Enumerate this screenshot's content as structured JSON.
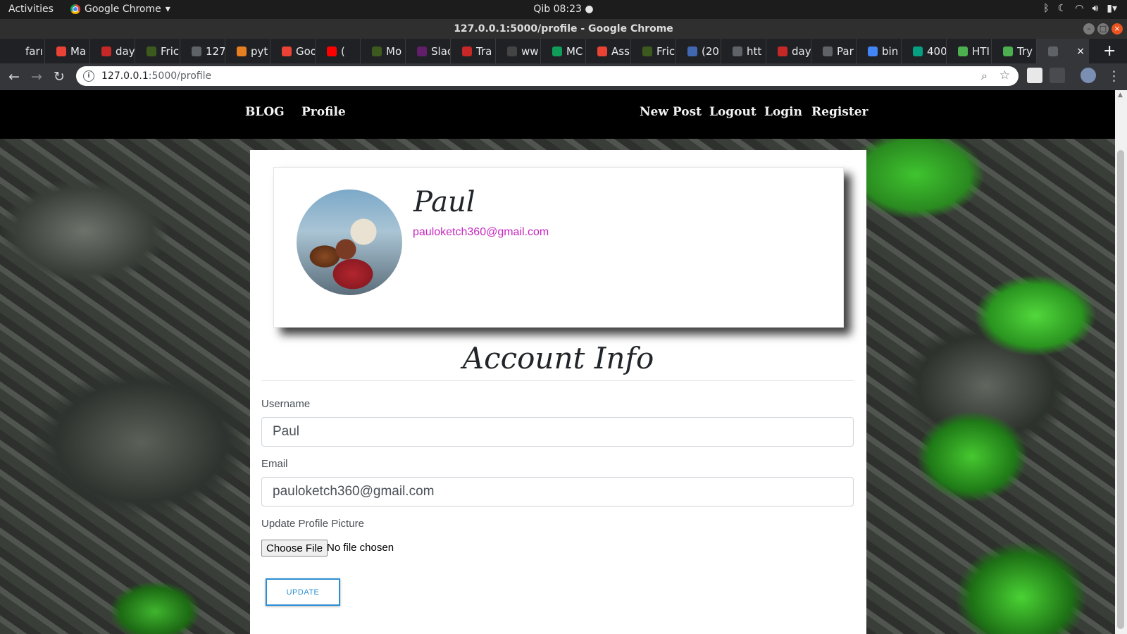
{
  "system_bar": {
    "activities": "Activities",
    "app_name": "Google Chrome",
    "clock": "Qib 08:23 ●"
  },
  "window": {
    "title": "127.0.0.1:5000/profile - Google Chrome"
  },
  "tabs": [
    {
      "label": "farı",
      "favicon_color": "#202124"
    },
    {
      "label": "Ma",
      "favicon_color": "#ea4335"
    },
    {
      "label": "day",
      "favicon_color": "#c62828"
    },
    {
      "label": "Fric",
      "favicon_color": "#3d5a1e"
    },
    {
      "label": "127",
      "favicon_color": "#5f6368"
    },
    {
      "label": "pyt",
      "favicon_color": "#e67e22"
    },
    {
      "label": "Goo",
      "favicon_color": "#ea4335"
    },
    {
      "label": "(",
      "favicon_color": "#ff0000"
    },
    {
      "label": "Mo",
      "favicon_color": "#3d5a1e"
    },
    {
      "label": "Slac",
      "favicon_color": "#611f69"
    },
    {
      "label": "Tra",
      "favicon_color": "#c62828"
    },
    {
      "label": "ww",
      "favicon_color": "#444"
    },
    {
      "label": "MC",
      "favicon_color": "#0f9d58"
    },
    {
      "label": "Ass",
      "favicon_color": "#ea4335"
    },
    {
      "label": "Fric",
      "favicon_color": "#3d5a1e"
    },
    {
      "label": "(20",
      "favicon_color": "#4267b2"
    },
    {
      "label": "htt",
      "favicon_color": "#5f6368"
    },
    {
      "label": "day",
      "favicon_color": "#c62828"
    },
    {
      "label": "Par",
      "favicon_color": "#5f6368"
    },
    {
      "label": "bin",
      "favicon_color": "#4285f4"
    },
    {
      "label": "400",
      "favicon_color": "#05a081"
    },
    {
      "label": "HTI",
      "favicon_color": "#4caf50"
    },
    {
      "label": "Try",
      "favicon_color": "#4caf50"
    },
    {
      "label": "",
      "favicon_color": "#5f6368",
      "active": true
    }
  ],
  "omnibox": {
    "host": "127.0.0.1",
    "path": ":5000/profile"
  },
  "site_nav": {
    "brand": "BLOG",
    "profile": "Profile",
    "new_post": "New Post",
    "logout": "Logout",
    "login": "Login",
    "register": "Register"
  },
  "profile_card": {
    "name": "Paul",
    "email": "pauloketch360@gmail.com"
  },
  "form": {
    "heading": "Account Info",
    "username_label": "Username",
    "username_value": "Paul",
    "email_label": "Email",
    "email_value": "pauloketch360@gmail.com",
    "picture_label": "Update Profile Picture",
    "choose_file": "Choose File",
    "file_status": "No file chosen",
    "submit": "UPDATE"
  },
  "colors": {
    "email_accent": "#c726c0",
    "button_accent": "#2c8fd4",
    "navbar_bg": "#000000"
  }
}
